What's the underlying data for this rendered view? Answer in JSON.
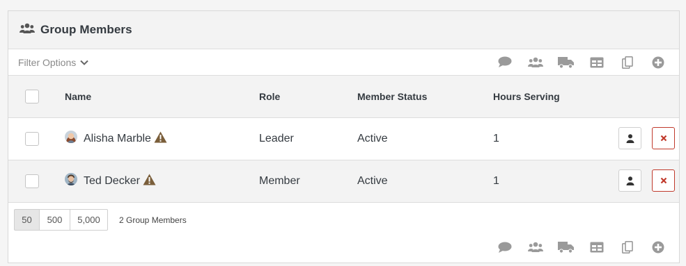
{
  "panel": {
    "title": "Group Members",
    "title_icon": "users-icon"
  },
  "filter": {
    "label": "Filter Options",
    "icon": "chevron-down-icon"
  },
  "toolbar_actions": [
    "communicate-icon",
    "merge-group-icon",
    "bulk-update-icon",
    "excel-export-icon",
    "merge-template-icon",
    "add-icon"
  ],
  "columns": {
    "name": "Name",
    "role": "Role",
    "status": "Member Status",
    "hours": "Hours Serving"
  },
  "rows": [
    {
      "name": "Alisha Marble",
      "role": "Leader",
      "status": "Active",
      "hours": "1"
    },
    {
      "name": "Ted Decker",
      "role": "Member",
      "status": "Active",
      "hours": "1"
    }
  ],
  "pager": {
    "sizes": [
      "50",
      "500",
      "5,000"
    ],
    "active": "50"
  },
  "count_text": "2 Group Members",
  "colors": {
    "icon_gray": "#9a9a9a",
    "danger": "#c0392b",
    "warning": "#7a5e3a",
    "header_bg": "#f3f3f3"
  }
}
